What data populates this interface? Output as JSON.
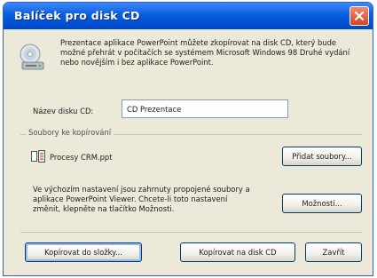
{
  "window": {
    "title": "Balíček pro disk CD"
  },
  "intro_text": "Prezentace aplikace PowerPoint můžete zkopírovat na disk CD, který bude možné přehrát v počítačích se systémem Microsoft Windows 98 Druhé vydání nebo novějším i bez aplikace PowerPoint.",
  "cd_name": {
    "label": "Název disku CD:",
    "value": "CD Prezentace"
  },
  "files_group": {
    "label": "Soubory ke kopírování",
    "file_name": "Procesy CRM.ppt",
    "add_files_button": "Přidat soubory..."
  },
  "info_text": "Ve výchozím nastavení jsou zahrnuty propojené soubory a aplikace PowerPoint Viewer. Chcete-li toto nastavení změnit, klepněte na tlačítko Možnosti.",
  "options_button": "Možnosti...",
  "footer": {
    "copy_to_folder_button": "Kopírovat do složky...",
    "copy_to_cd_button": "Kopírovat na disk CD",
    "close_button": "Zavřít"
  }
}
